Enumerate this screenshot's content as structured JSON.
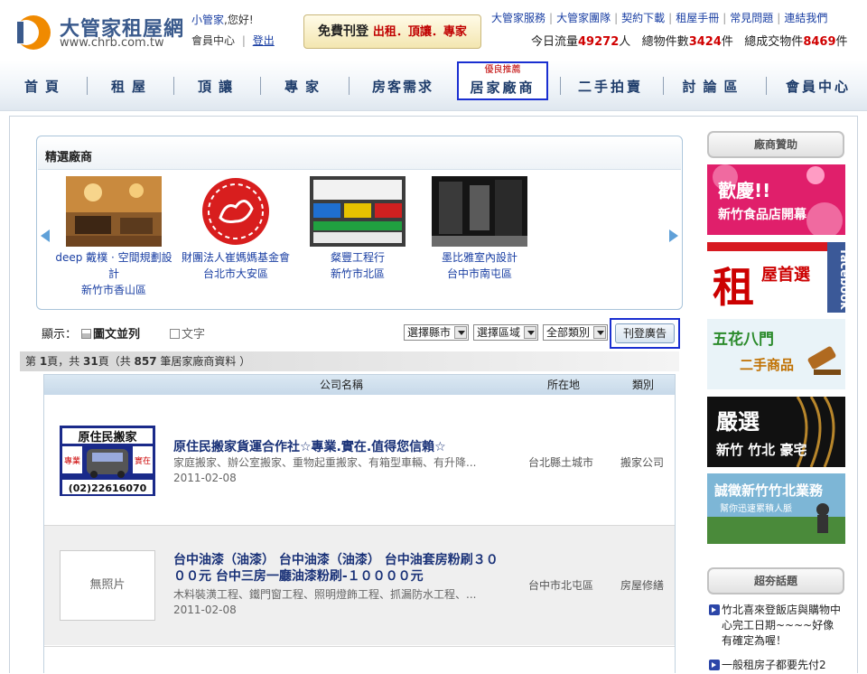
{
  "header": {
    "logo_title": "大管家租屋網",
    "logo_url": "www.chrb.com.tw",
    "username": "小管家",
    "greeting": ",您好!",
    "member_center": "會員中心",
    "separator": "|",
    "logout": "登出",
    "free_ad_prefix": "免費刊登",
    "free_ad_highlight": "出租．頂讓．專家",
    "top_links": [
      "大管家服務",
      "大管家團隊",
      "契約下載",
      "租屋手冊",
      "常見問題",
      "連結我們"
    ],
    "stats": {
      "traffic_label": "今日流量",
      "traffic_value": "49272",
      "traffic_unit": "人",
      "listings_label": "總物件數",
      "listings_value": "3424",
      "listings_unit": "件",
      "deals_label": "總成交物件",
      "deals_value": "8469",
      "deals_unit": "件"
    }
  },
  "nav": {
    "items": [
      "首頁",
      "租屋",
      "頂讓",
      "專家",
      "房客需求",
      "居家廠商",
      "二手拍賣",
      "討論區",
      "會員中心"
    ],
    "active_badge": "優良推薦"
  },
  "featured": {
    "title": "精選廠商",
    "vendors": [
      {
        "name": "deep 戴樸 · 空間規劃設計",
        "area": "新竹市香山區"
      },
      {
        "name": "財團法人崔媽媽基金會",
        "area": "台北市大安區"
      },
      {
        "name": "粲豐工程行",
        "area": "新竹市北區"
      },
      {
        "name": "墨比雅室內設計",
        "area": "台中市南屯區"
      }
    ]
  },
  "toolbar": {
    "display_label": "顯示：",
    "view_image": "圖文並列",
    "view_text": "文字",
    "filters": [
      "選擇縣市",
      "選擇區域",
      "全部類別"
    ],
    "post_ad": "刊登廣告"
  },
  "pageinfo": {
    "text_a": "第 ",
    "page": "1",
    "text_b": "頁，共 ",
    "pages": "31",
    "text_c": "頁（共 ",
    "total": "857",
    "text_d": " 筆居家廠商資料 ）"
  },
  "listing": {
    "columns": [
      "公司名稱",
      "所在地",
      "類別"
    ],
    "rows": [
      {
        "title": "原住民搬家貨運合作社☆專業.實在.值得您信賴☆",
        "desc": "家庭搬家、辦公室搬家、重物起重搬家、有箱型車輛、有升降...",
        "date": "2011-02-08",
        "location": "台北縣土城市",
        "category": "搬家公司",
        "thumb_text_top": "原住民搬家",
        "thumb_left": "專業",
        "thumb_right": "實在",
        "thumb_phone": "(02)22616070"
      },
      {
        "title": "台中油漆（油漆） 台中油漆（油漆） 台中油套房粉刷３０００元 台中三房一廳油漆粉刷-１００００元",
        "desc": "木料裝潢工程、鐵門窗工程、照明燈飾工程、抓漏防水工程、...",
        "date": "2011-02-08",
        "location": "台中市北屯區",
        "category": "房屋修繕",
        "no_photo": "無照片"
      }
    ]
  },
  "sidebar": {
    "sponsor_title": "廠商贊助",
    "ads": [
      {
        "line1": "歡慶!!",
        "line2": "新竹食品店開幕"
      },
      {
        "char": "租",
        "text": "屋首選",
        "side": "facebook"
      },
      {
        "line1": "五花八門",
        "line2": "二手商品"
      },
      {
        "line1": "嚴選",
        "line2": "新竹 竹北 豪宅"
      },
      {
        "line1": "誠徵新竹竹北業務",
        "line2": "幫你迅速累積人脈"
      }
    ],
    "hot_title": "超夯話題",
    "news": [
      "竹北喜來登飯店與購物中心完工日期~~~~好像有確定為喔！",
      "一般租房子都要先付2"
    ]
  },
  "colors": {
    "accent_blue": "#1a2fd1",
    "stat_red": "#d00000",
    "nav_text": "#1f3d6b"
  }
}
